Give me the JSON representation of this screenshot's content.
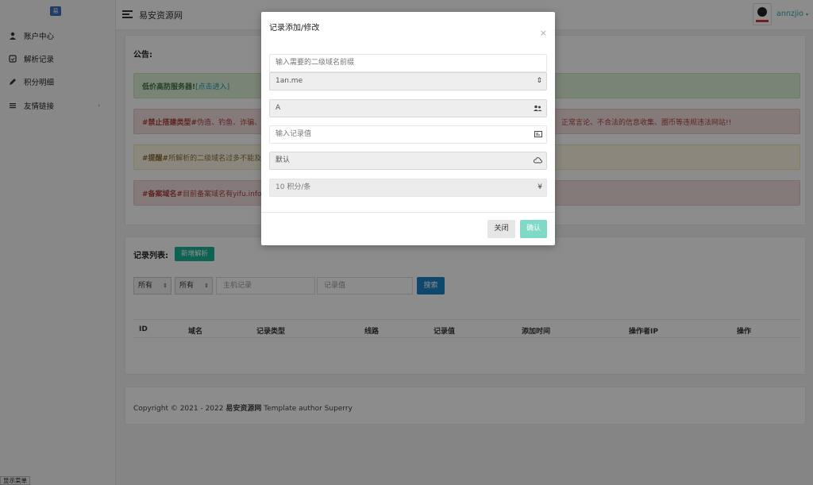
{
  "sidebar": {
    "items": [
      {
        "label": "账户中心",
        "icon": "user-icon"
      },
      {
        "label": "解析记录",
        "icon": "record-icon"
      },
      {
        "label": "积分明细",
        "icon": "pencil-icon"
      },
      {
        "label": "友情链接",
        "icon": "list-icon"
      }
    ],
    "toggle_tip": "显示菜单"
  },
  "topbar": {
    "site_title": "易安资源网",
    "username": "annzjio"
  },
  "announcement": {
    "title": "公告:",
    "notice1_text": "低价高防服务器!",
    "notice1_link": "[点击进入]",
    "notice2_tag": "#禁止搭建类型#",
    "notice2_text": " 伪造、钓鱼、诈骗、外",
    "notice2_tail": "正常言论、不合法的信息收集、圈币等违规违法网站!!",
    "notice3_tag": "#提醒#",
    "notice3_text": " 所解析的二级域名过多不能及时",
    "notice4_tag": "#备案域名#",
    "notice4_text": " 目前备案域名有yifu.info ("
  },
  "records": {
    "title": "记录列表:",
    "add_button": "新增解析",
    "filter1": "所有",
    "filter2": "所有",
    "host_placeholder": "主机记录",
    "value_placeholder": "记录值",
    "search_button": "搜索",
    "columns": [
      "ID",
      "域名",
      "记录类型",
      "线路",
      "记录值",
      "添加时间",
      "操作者IP",
      "操作"
    ]
  },
  "footer": {
    "prefix": "Copyright © 2021 - 2022 ",
    "site": "易安资源网",
    "suffix": " Template author Superry"
  },
  "modal": {
    "title": "记录添加/修改",
    "close_icon": "×",
    "prefix_placeholder": "输入需要的二级域名前缀",
    "domain_value": "1an.me",
    "type_value": "A",
    "value_placeholder": "输入记录值",
    "line_value": "默认",
    "cost_value": "10 积分/条",
    "cost_icon": "¥",
    "close_button": "关闭",
    "confirm_button": "确认"
  },
  "colors": {
    "accent": "#1ab394",
    "search": "#1c84c6"
  }
}
